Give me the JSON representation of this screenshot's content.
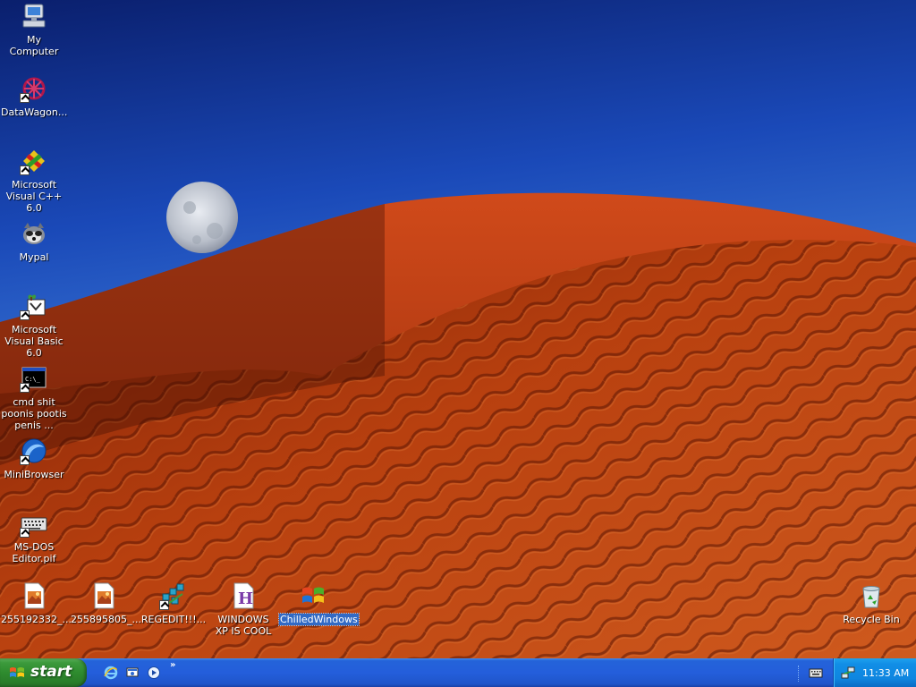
{
  "desktop": {
    "icons": [
      {
        "label": "My Computer",
        "icon": "my-computer-icon"
      },
      {
        "label": "DataWagon...",
        "icon": "datawagon-icon"
      },
      {
        "label": "Microsoft Visual C++ 6.0",
        "icon": "visual-cpp-icon"
      },
      {
        "label": "Mypal",
        "icon": "mypal-browser-icon"
      },
      {
        "label": "Microsoft Visual Basic 6.0",
        "icon": "visual-basic-icon"
      },
      {
        "label": "cmd shit poonis pootis penis ...",
        "icon": "command-prompt-icon"
      },
      {
        "label": "MiniBrowser",
        "icon": "minibrowser-icon"
      },
      {
        "label": "MS-DOS Editor.pif",
        "icon": "keyboard-icon"
      },
      {
        "label": "255192332_...",
        "icon": "image-file-icon"
      },
      {
        "label": "255895805_...",
        "icon": "image-file-icon"
      },
      {
        "label": "REGEDIT!!!...",
        "icon": "regedit-icon"
      },
      {
        "label": "WINDOWS XP IS COOL",
        "icon": "html-help-file-icon"
      },
      {
        "label": "ChilledWindows",
        "icon": "windows-logo-icon",
        "selected": true
      },
      {
        "label": "Recycle Bin",
        "icon": "recycle-bin-icon"
      }
    ]
  },
  "taskbar": {
    "start_label": "start",
    "quick_launch": [
      "internet-explorer-icon",
      "show-desktop-icon",
      "media-player-icon"
    ],
    "overflow": "»",
    "tray": {
      "icons": [
        "keyboard-language-icon",
        "network-icon"
      ],
      "clock": "11:33 AM"
    }
  },
  "colors": {
    "taskbar_blue": "#245edb",
    "start_green": "#3c9a3c",
    "tray_blue": "#0f86e0",
    "selection": "#316ac5"
  }
}
